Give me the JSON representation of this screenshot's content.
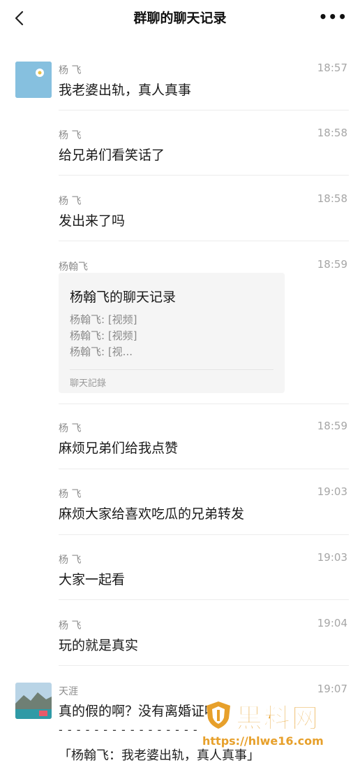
{
  "header": {
    "title": "群聊的聊天记录"
  },
  "messages": [
    {
      "sender": "杨 飞",
      "time": "18:57",
      "text": "我老婆出轨，真人真事"
    },
    {
      "sender": "杨 飞",
      "time": "18:58",
      "text": "给兄弟们看笑话了"
    },
    {
      "sender": "杨 飞",
      "time": "18:58",
      "text": "发出来了吗"
    },
    {
      "sender": "杨翰飞",
      "time": "18:59"
    },
    {
      "sender": "杨 飞",
      "time": "18:59",
      "text": "麻烦兄弟们给我点赞"
    },
    {
      "sender": "杨 飞",
      "time": "19:03",
      "text": "麻烦大家给喜欢吃瓜的兄弟转发"
    },
    {
      "sender": "杨 飞",
      "time": "19:03",
      "text": "大家一起看"
    },
    {
      "sender": "杨 飞",
      "time": "19:04",
      "text": "玩的就是真实"
    },
    {
      "sender": "天涯",
      "time": "19:07",
      "text": "真的假的啊？没有离婚证吗？"
    }
  ],
  "record_card": {
    "title": "杨翰飞的聊天记录",
    "lines": [
      "杨翰飞: [视频]",
      "杨翰飞: [视频]",
      "杨翰飞: [视..."
    ],
    "footer": "聊天記錄"
  },
  "quote": {
    "dashes": "- - - - - - - - - - - - - - - -",
    "text": "「杨翰飞：我老婆出轨，真人真事」"
  },
  "watermark": {
    "brand": "黑料网",
    "url": "https://hlwe16.com"
  },
  "icons": {
    "back": "chevron-left-icon",
    "more": "more-dots-icon",
    "watermark": "shield-logo-icon"
  },
  "colors": {
    "accent": "#e7a02b"
  }
}
